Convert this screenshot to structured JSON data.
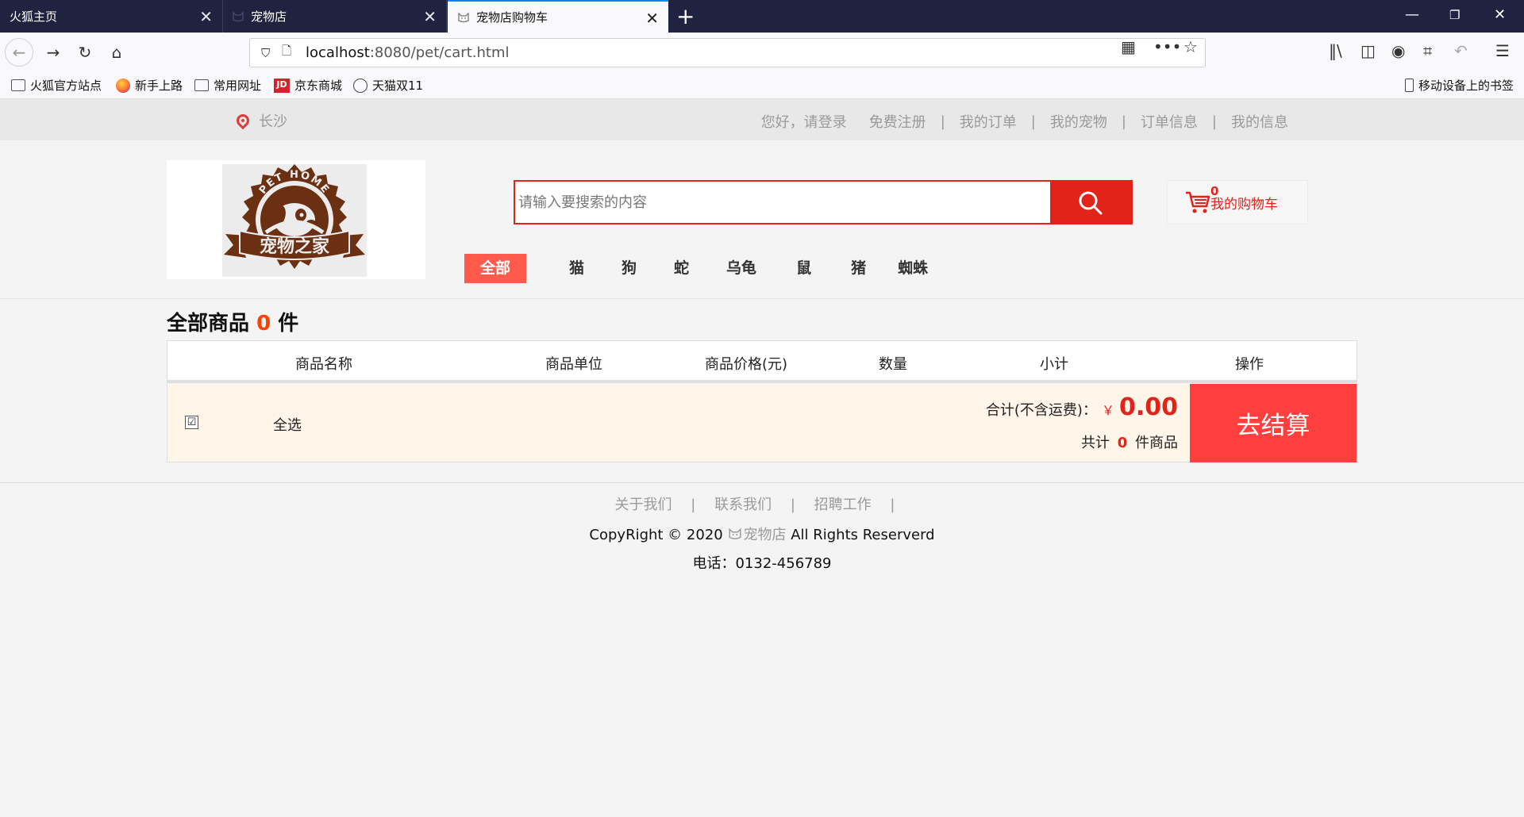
{
  "browser": {
    "tabs": [
      {
        "title": "火狐主页",
        "active": false
      },
      {
        "title": "宠物店",
        "active": false
      },
      {
        "title": "宠物店购物车",
        "active": true
      }
    ],
    "url_host": "localhost",
    "url_rest": ":8080/pet/cart.html",
    "bookmarks": [
      {
        "label": "火狐官方站点",
        "icon": "folder-icon"
      },
      {
        "label": "新手上路",
        "icon": "firefox-icon"
      },
      {
        "label": "常用网址",
        "icon": "folder-icon"
      },
      {
        "label": "京东商城",
        "icon": "jd-icon",
        "icon_text": "JD"
      },
      {
        "label": "天猫双11",
        "icon": "globe-icon"
      }
    ],
    "mobile_bookmarks": "移动设备上的书签"
  },
  "topbar": {
    "city": "长沙",
    "greeting": "您好，请登录",
    "links": [
      "免费注册",
      "我的订单",
      "我的宠物",
      "订单信息",
      "我的信息"
    ],
    "separator": "|"
  },
  "logo": {
    "top_text": "PET HOME",
    "main_text": "宠物之家"
  },
  "search": {
    "placeholder": "请输入要搜索的内容"
  },
  "cart_mini": {
    "label": "我的购物车",
    "count": "0"
  },
  "categories": [
    "全部",
    "猫",
    "狗",
    "蛇",
    "乌龟",
    "鼠",
    "猪",
    "蜘蛛"
  ],
  "cart": {
    "title_prefix": "全部商品",
    "count": "0",
    "title_suffix": "件",
    "columns": [
      "商品名称",
      "商品单位",
      "商品价格(元)",
      "数量",
      "小计",
      "操作"
    ],
    "select_all_mark": "☑",
    "select_all_label": "全选",
    "total_label": "合计(不含运费)：",
    "currency": "￥",
    "total_amount": "0.00",
    "count_prefix": "共计",
    "count_value": "0",
    "count_suffix": "件商品",
    "checkout_label": "去结算"
  },
  "footer": {
    "links": [
      "关于我们",
      "联系我们",
      "招聘工作"
    ],
    "separator": "|",
    "copyright_prefix": "CopyRight © 2020",
    "copyright_brand": "宠物店",
    "copyright_suffix": "All Rights Reserverd",
    "phone": "电话：0132-456789"
  },
  "colors": {
    "accent": "#e2231a",
    "category_active": "#ff5a4c",
    "checkout": "#ff3e3e",
    "count": "#ff4000"
  }
}
